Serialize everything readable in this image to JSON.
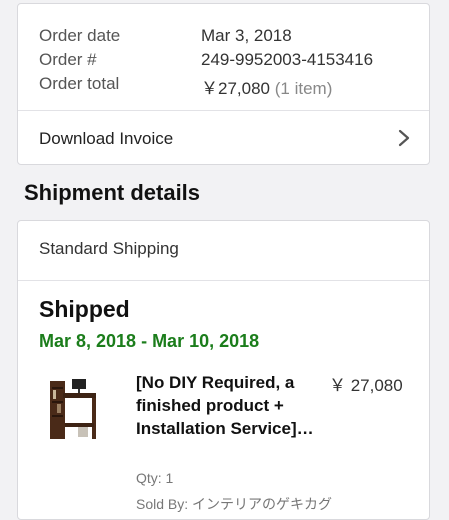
{
  "order_summary": {
    "date_label": "Order date",
    "date_value": "Mar 3, 2018",
    "number_label": "Order #",
    "number_value": "249-9952003-4153416",
    "total_label": "Order total",
    "total_value": "￥27,080",
    "total_items": "(1 item)",
    "invoice_label": "Download Invoice",
    "invoice_icon": "chevron-right-icon"
  },
  "shipment": {
    "section_title": "Shipment details",
    "method": "Standard Shipping",
    "status": "Shipped",
    "delivery_dates": "Mar 8, 2018 - Mar 10, 2018",
    "status_color": "#1b7d1b",
    "item": {
      "title": "[No DIY Required, a finished product + Installation Service]…",
      "price": "￥ 27,080",
      "qty": "Qty: 1",
      "seller": "Sold By: インテリアのゲキカグ",
      "image_icon": "desk-product-image"
    }
  }
}
